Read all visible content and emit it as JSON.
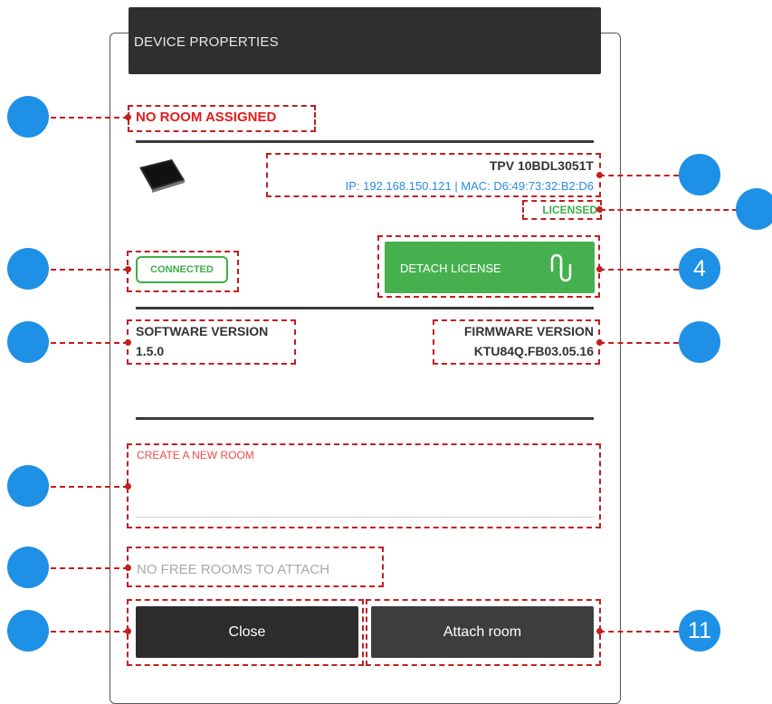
{
  "header": {
    "title": "DEVICE PROPERTIES"
  },
  "room_status": "NO ROOM ASSIGNED",
  "device": {
    "model": "TPV 10BDL3051T",
    "network": "IP: 192.168.150.121 | MAC: D6:49:73:32:B2:D6",
    "license_status": "LICENSED",
    "connection_status": "CONNECTED"
  },
  "detach_button": {
    "label": "DETACH LICENSE",
    "icon": "link-icon"
  },
  "software": {
    "label": "SOFTWARE VERSION",
    "value": "1.5.0"
  },
  "firmware": {
    "label": "FIRMWARE VERSION",
    "value": "KTU84Q.FB03.05.16"
  },
  "create_room": {
    "label": "CREATE A NEW ROOM",
    "value": ""
  },
  "attach_status": "NO FREE ROOMS TO ATTACH",
  "buttons": {
    "close": "Close",
    "attach": "Attach room"
  },
  "callouts": {
    "detach": "4",
    "actions": "11"
  },
  "colors": {
    "header_bg": "#2f2f2f",
    "accent_green": "#46b04e",
    "status_green": "#3fae49",
    "alert_red": "#e21c1c",
    "link_blue": "#2b8ae0",
    "callout_blue": "#1e90e6",
    "annotation_red": "#c21f1f"
  }
}
